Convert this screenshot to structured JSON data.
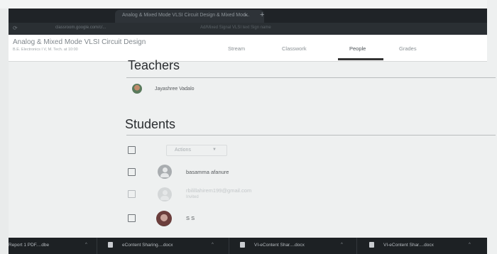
{
  "browser": {
    "tab_title": "Analog & Mixed Mode VLSI Circuit Design & Mixed Mod...",
    "tab_close": "×",
    "new_tab": "+",
    "address_text": "classroom.google.com/c/...",
    "address_ghost": "Ad/Mixed Signal VLSI text Sign name"
  },
  "header": {
    "class_name": "Analog & Mixed Mode VLSI Circuit Design",
    "class_section": "B.E. Electronics I  V, M. Tech. at 10:00",
    "tabs": [
      {
        "label": "Stream"
      },
      {
        "label": "Classwork"
      },
      {
        "label": "People"
      },
      {
        "label": "Grades"
      }
    ]
  },
  "teachers": {
    "heading": "Teachers",
    "list": [
      {
        "name": "Jayashree Vadalo"
      }
    ]
  },
  "students": {
    "heading": "Students",
    "actions_label": "Actions",
    "list": [
      {
        "name": "basamma afanure"
      },
      {
        "email": "rbilillahirem199@gmail.com",
        "status": "Invited"
      },
      {
        "name": "S S"
      }
    ]
  },
  "taskbar": {
    "items": [
      {
        "label": "Report 1 PDF....dbe"
      },
      {
        "label": "eContent Sharing....docx"
      },
      {
        "label": "VI-eContent Shar....docx"
      },
      {
        "label": "VI-eContent Shar....docx"
      }
    ]
  },
  "colors": {
    "background": "#eef0f0",
    "header": "#ffffff",
    "tabstrip": "#1f2327",
    "taskbar": "#1d2124",
    "active_tab_underline": "#333333"
  }
}
